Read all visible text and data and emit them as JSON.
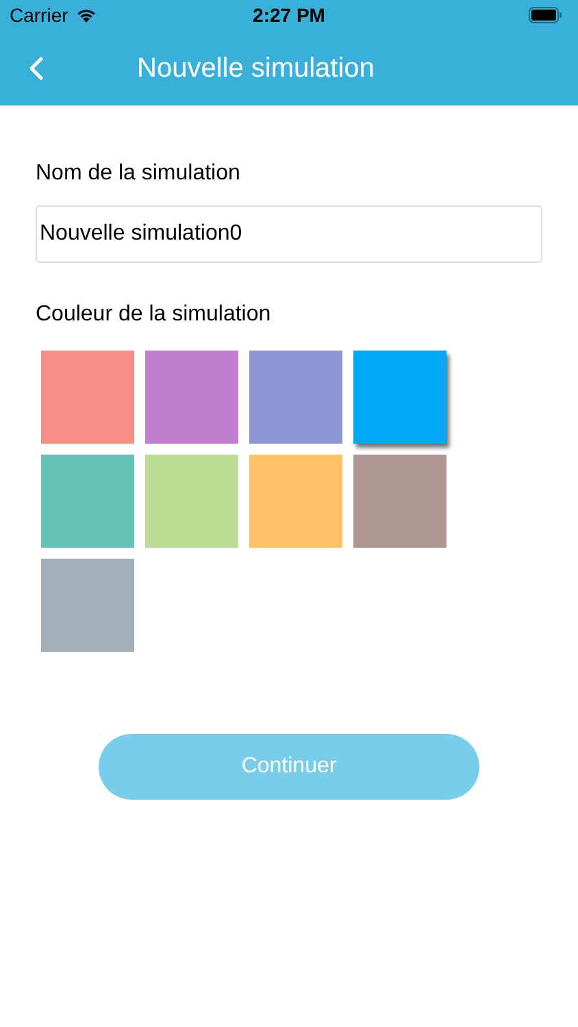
{
  "status_bar": {
    "carrier": "Carrier",
    "time": "2:27 PM"
  },
  "nav": {
    "title": "Nouvelle simulation"
  },
  "name_field": {
    "label": "Nom de la simulation",
    "value": "Nouvelle simulation0"
  },
  "colors": {
    "label": "Couleur de la simulation",
    "swatches": [
      {
        "color": "#f88f87",
        "selected": false
      },
      {
        "color": "#c27ecf",
        "selected": false
      },
      {
        "color": "#8d97d4",
        "selected": false
      },
      {
        "color": "#03a9f4",
        "selected": true
      },
      {
        "color": "#67c1b7",
        "selected": false
      },
      {
        "color": "#bbdc94",
        "selected": false
      },
      {
        "color": "#fec268",
        "selected": false
      },
      {
        "color": "#af9891",
        "selected": false
      },
      {
        "color": "#a1b0b8",
        "selected": false
      }
    ]
  },
  "continue_button": {
    "label": "Continuer",
    "disabled": true
  }
}
